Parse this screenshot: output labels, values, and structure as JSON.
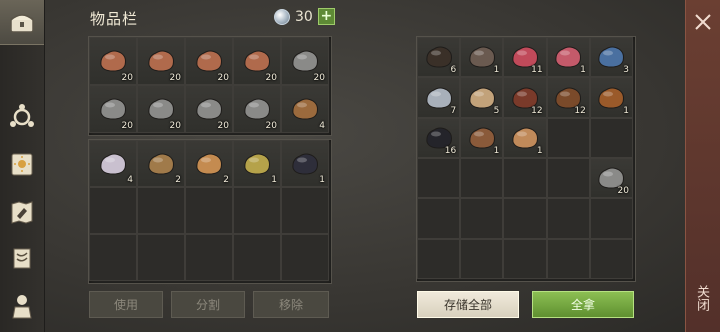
{
  "header": {
    "title": "物品栏",
    "coin_count": "30",
    "plus_label": "+"
  },
  "nav": {
    "items": [
      {
        "name": "chest-icon"
      },
      {
        "name": "crafting-icon"
      },
      {
        "name": "sun-book-icon"
      },
      {
        "name": "build-map-icon"
      },
      {
        "name": "scroll-icon"
      },
      {
        "name": "character-icon"
      }
    ]
  },
  "left_inventory": {
    "items": [
      {
        "name": "copper-ore",
        "count": "20",
        "color": "#b06a4c"
      },
      {
        "name": "copper-ore",
        "count": "20",
        "color": "#b06a4c"
      },
      {
        "name": "copper-ore",
        "count": "20",
        "color": "#b06a4c"
      },
      {
        "name": "copper-ore",
        "count": "20",
        "color": "#b06a4c"
      },
      {
        "name": "stone",
        "count": "20",
        "color": "#8a8a88"
      },
      {
        "name": "stone",
        "count": "20",
        "color": "#8a8a88"
      },
      {
        "name": "stone",
        "count": "20",
        "color": "#8a8a88"
      },
      {
        "name": "stone",
        "count": "20",
        "color": "#8a8a88"
      },
      {
        "name": "stone",
        "count": "20",
        "color": "#8a8a88"
      },
      {
        "name": "crossed-pickaxes",
        "count": "4",
        "color": "#9b6a3d"
      }
    ],
    "lower_items": [
      {
        "name": "cloth-roll",
        "count": "4",
        "color": "#c9c0cf"
      },
      {
        "name": "seed-pile",
        "count": "2",
        "color": "#a07a4a"
      },
      {
        "name": "grain-pile",
        "count": "2",
        "color": "#c48b50"
      },
      {
        "name": "sulfur-powder",
        "count": "1",
        "color": "#b5a24a"
      },
      {
        "name": "coal-pile",
        "count": "1",
        "color": "#2e2e3a"
      }
    ]
  },
  "buttons": {
    "use": "使用",
    "split": "分割",
    "remove": "移除",
    "store_all": "存储全部",
    "take_all": "全拿"
  },
  "storage": {
    "items": [
      {
        "name": "rope-coil",
        "count": "6",
        "color": "#3a3028"
      },
      {
        "name": "net",
        "count": "1",
        "color": "#6a5a50"
      },
      {
        "name": "raw-meat",
        "count": "11",
        "color": "#c04a5a"
      },
      {
        "name": "berry-bowl",
        "count": "1",
        "color": "#c45a6a"
      },
      {
        "name": "potion-bottle",
        "count": "3",
        "color": "#4a70a0"
      },
      {
        "name": "iron-ore",
        "count": "7",
        "color": "#a8b0ba"
      },
      {
        "name": "coiled-rope",
        "count": "5",
        "color": "#c2a27a"
      },
      {
        "name": "fiber-net",
        "count": "12",
        "color": "#7a3a2a"
      },
      {
        "name": "bark-strips",
        "count": "12",
        "color": "#7a4a2a"
      },
      {
        "name": "barrel",
        "count": "1",
        "color": "#9a5a2a"
      },
      {
        "name": "coal-lumps",
        "count": "16",
        "color": "#24242a"
      },
      {
        "name": "leather-scroll",
        "count": "1",
        "color": "#8a5a3a"
      },
      {
        "name": "fabric-sheets",
        "count": "1",
        "color": "#c08a5a"
      },
      {
        "name": "stone",
        "count": "20",
        "color": "#8a8a88"
      }
    ]
  },
  "close_label": "关闭"
}
